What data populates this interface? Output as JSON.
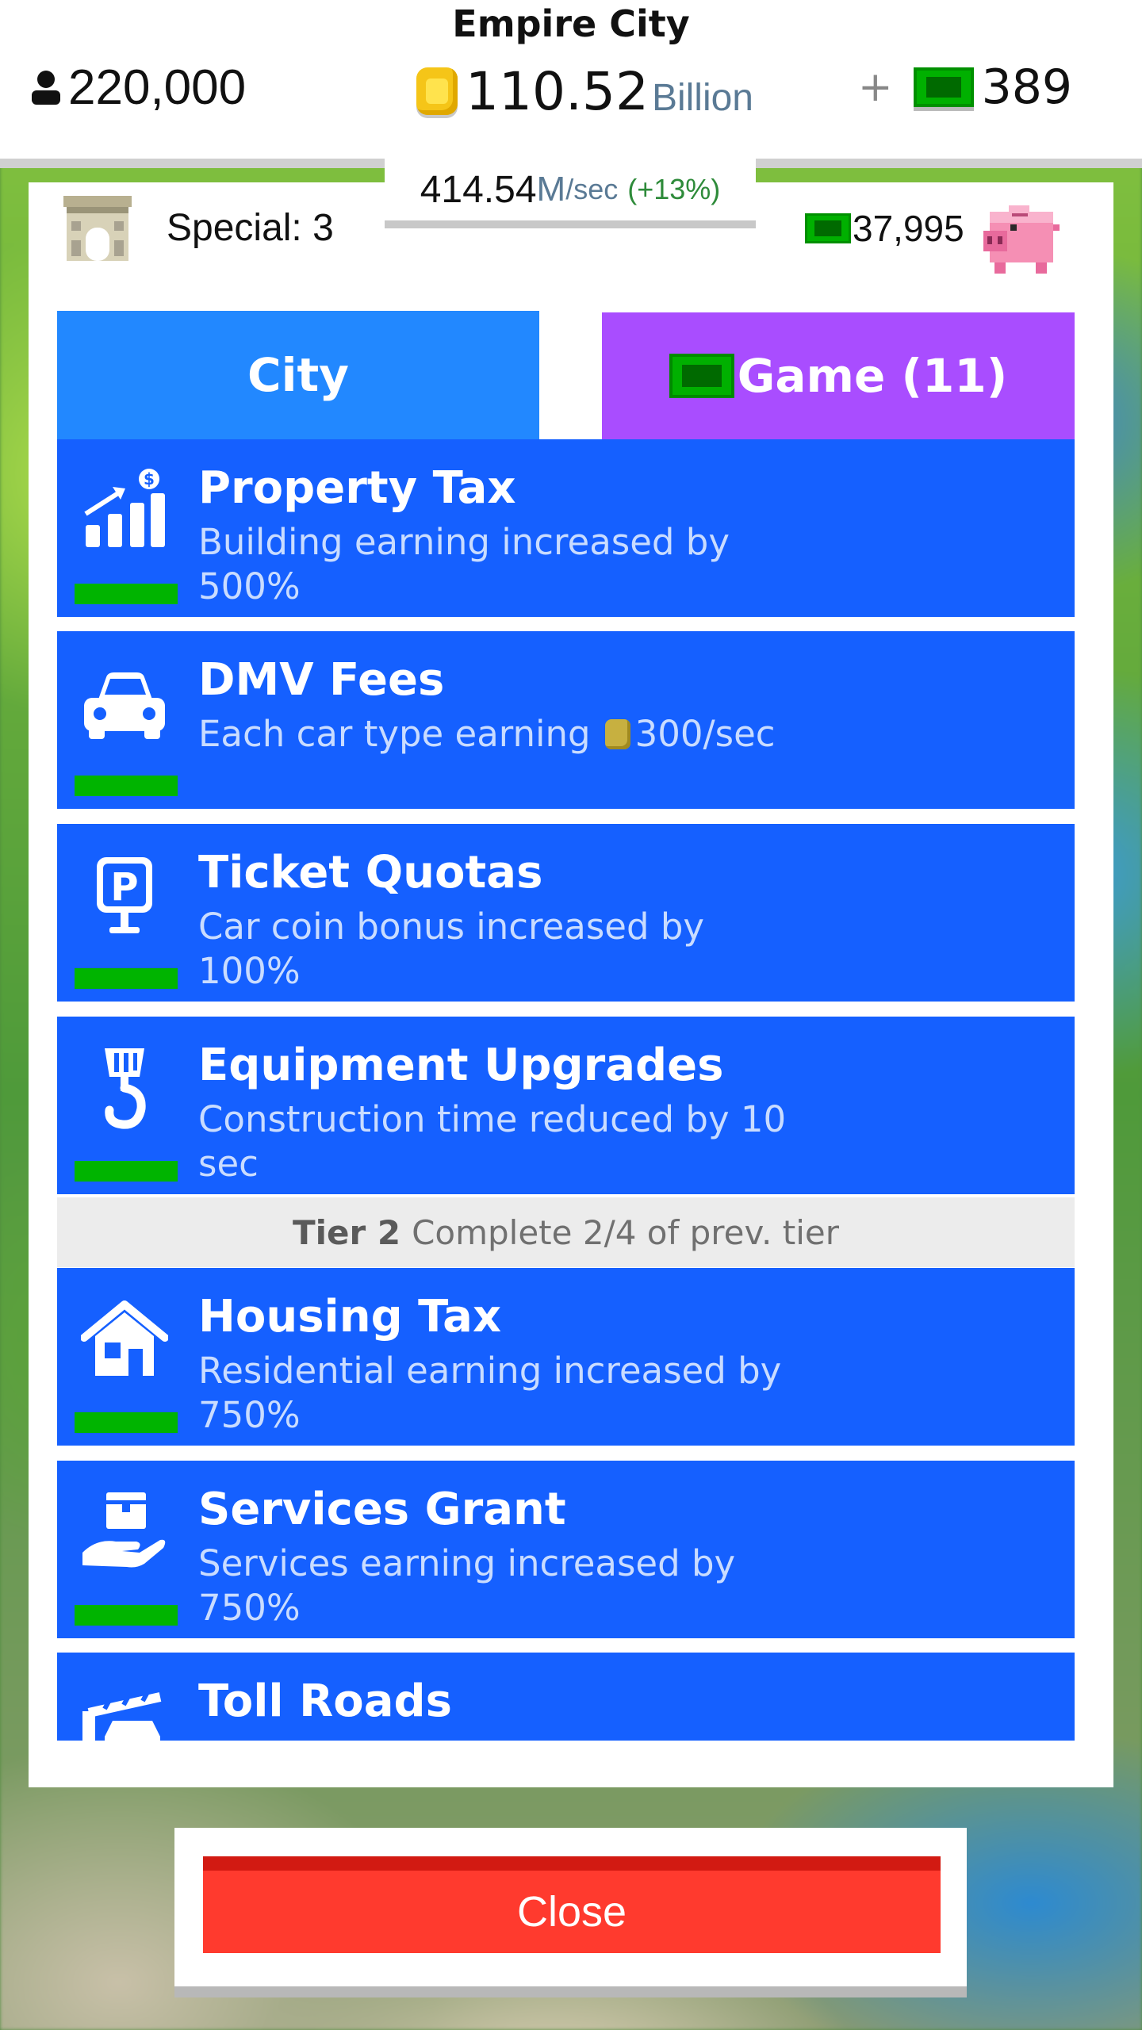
{
  "header": {
    "city_name": "Empire City",
    "population": "220,000",
    "coins": "110.52",
    "coins_unit": "Billion",
    "cash_plus": "+",
    "cash": "389"
  },
  "income": {
    "value": "414.54",
    "unit": "M",
    "per": "/sec",
    "percent": "(+13%)"
  },
  "panel": {
    "special_label": "Special: 3",
    "bank_amount": "37,995"
  },
  "tabs": {
    "city": "City",
    "game": "Game (11)"
  },
  "upgrades": [
    {
      "title": "Property Tax",
      "description": "Building earning increased by 500%",
      "icon": "rising-chart-icon"
    },
    {
      "title": "DMV Fees",
      "description_prefix": "Each car type earning",
      "description_value": "300/sec",
      "icon": "car-icon"
    },
    {
      "title": "Ticket Quotas",
      "description": "Car coin bonus increased by 100%",
      "icon": "parking-sign-icon"
    },
    {
      "title": "Equipment Upgrades",
      "description": "Construction time reduced by 10 sec",
      "icon": "crane-hook-icon"
    },
    {
      "title": "Housing Tax",
      "description": "Residential earning increased by 750%",
      "icon": "house-icon"
    },
    {
      "title": "Services Grant",
      "description": "Services earning increased by 750%",
      "icon": "hand-box-icon"
    },
    {
      "title": "Toll Roads",
      "description": "",
      "icon": "toll-gate-icon"
    }
  ],
  "tier": {
    "label": "Tier 2",
    "requirement": "Complete 2/4 of prev. tier"
  },
  "close_label": "Close",
  "colors": {
    "item_bg": "#1560ff",
    "city_tab": "#2288ff",
    "game_tab": "#a94dff",
    "progress": "#00b400",
    "close": "#ff3a2e"
  }
}
